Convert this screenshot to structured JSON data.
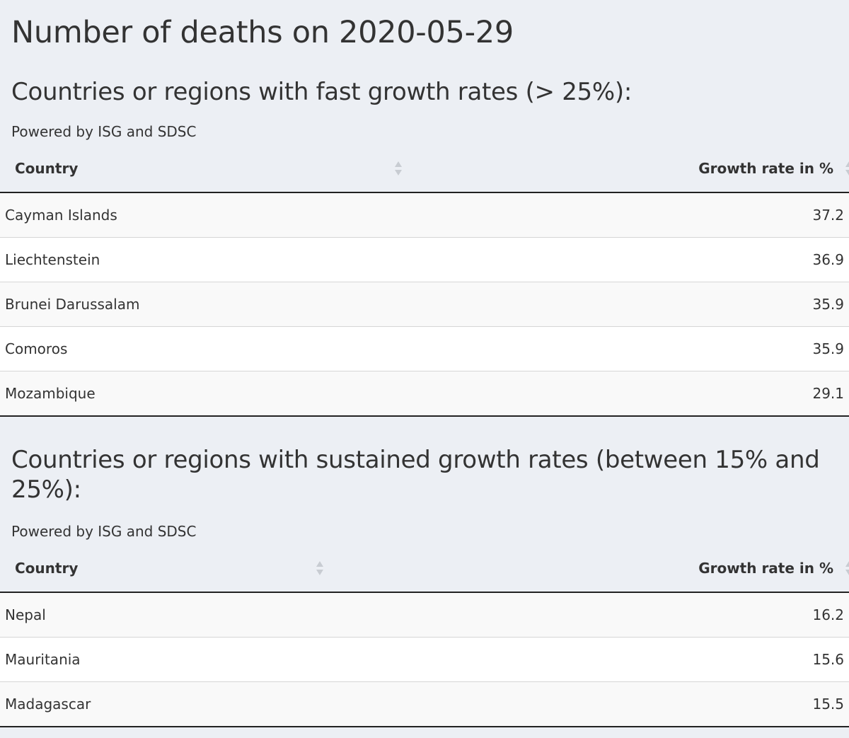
{
  "page": {
    "title": "Number of deaths on 2020-05-29"
  },
  "sections": [
    {
      "heading": "Countries or regions with fast growth rates (> 25%):",
      "powered_by": "Powered by ISG and SDSC",
      "columns": [
        "Country",
        "Growth rate in %"
      ],
      "rows": [
        {
          "country": "Cayman Islands",
          "growth": "37.2"
        },
        {
          "country": "Liechtenstein",
          "growth": "36.9"
        },
        {
          "country": "Brunei Darussalam",
          "growth": "35.9"
        },
        {
          "country": "Comoros",
          "growth": "35.9"
        },
        {
          "country": "Mozambique",
          "growth": "29.1"
        }
      ]
    },
    {
      "heading": "Countries or regions with sustained growth rates (between 15% and 25%):",
      "powered_by": "Powered by ISG and SDSC",
      "columns": [
        "Country",
        "Growth rate in %"
      ],
      "rows": [
        {
          "country": "Nepal",
          "growth": "16.2"
        },
        {
          "country": "Mauritania",
          "growth": "15.6"
        },
        {
          "country": "Madagascar",
          "growth": "15.5"
        }
      ]
    }
  ],
  "icons": {
    "sort": "sort-both-icon"
  },
  "colors": {
    "background": "#eceff4",
    "row_odd": "#f9f9f9",
    "row_even": "#ffffff",
    "text": "#333333",
    "sort_icon": "#c8ccd2"
  }
}
